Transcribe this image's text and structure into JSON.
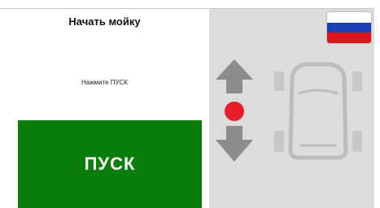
{
  "panel": {
    "title": "Начать мойку",
    "hint": "Нажмите ПУСК",
    "start_button_label": "ПУСК"
  },
  "language": {
    "flag_name": "russia-flag-icon",
    "flag_colors": [
      "#ffffff",
      "#1d3fb6",
      "#d8161c"
    ]
  },
  "position_indicator": {
    "up_arrow_icon": "arrow-up-icon",
    "down_arrow_icon": "arrow-down-icon",
    "stop_dot_icon": "red-dot-icon",
    "vehicle_icon": "car-top-view-icon"
  },
  "colors": {
    "start_button": "#0a7d0a",
    "right_panel_bg": "#dcdcdc",
    "arrow": "#8c8c8c",
    "dot": "#e5202a",
    "vehicle_outline": "#bdbdbd"
  }
}
